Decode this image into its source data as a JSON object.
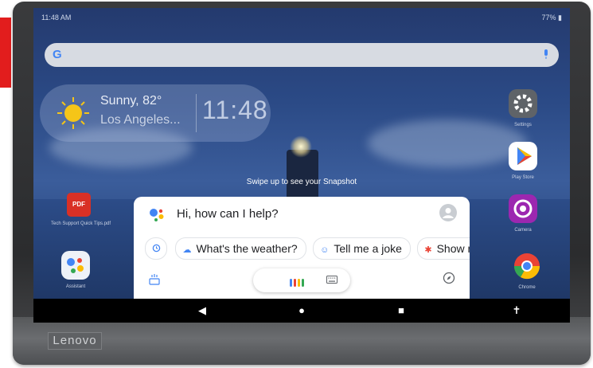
{
  "device": {
    "brand": "Lenovo"
  },
  "statusbar": {
    "left": "11:48 AM",
    "right": "77% ▮"
  },
  "search": {
    "logo": "G",
    "mic_icon": "mic-icon"
  },
  "weather": {
    "condition": "Sunny, 82°",
    "location": "Los Angeles...",
    "time": "11:48"
  },
  "snapshot_hint": "Swipe up to see your Snapshot",
  "apps": {
    "settings": "Settings",
    "play_store": "Play Store",
    "camera": "Camera",
    "chrome": "Chrome",
    "pdf": "Tech Support Quick Tips.pdf",
    "assistant": "Assistant"
  },
  "assistant": {
    "greeting": "Hi, how can I help?",
    "chips": [
      {
        "label": "What's the weather?",
        "icon": "cloud-icon"
      },
      {
        "label": "Tell me a joke",
        "icon": "smile-icon"
      },
      {
        "label": "Show m",
        "icon": "pinwheel-icon"
      }
    ]
  },
  "nav": {
    "back": "◀",
    "home": "●",
    "recents": "■",
    "accessibility": "✝"
  },
  "colors": {
    "accent_red": "#e21d1d",
    "google_blue": "#4285f4",
    "google_red": "#ea4335",
    "google_yellow": "#fbbc05",
    "google_green": "#34a853"
  }
}
